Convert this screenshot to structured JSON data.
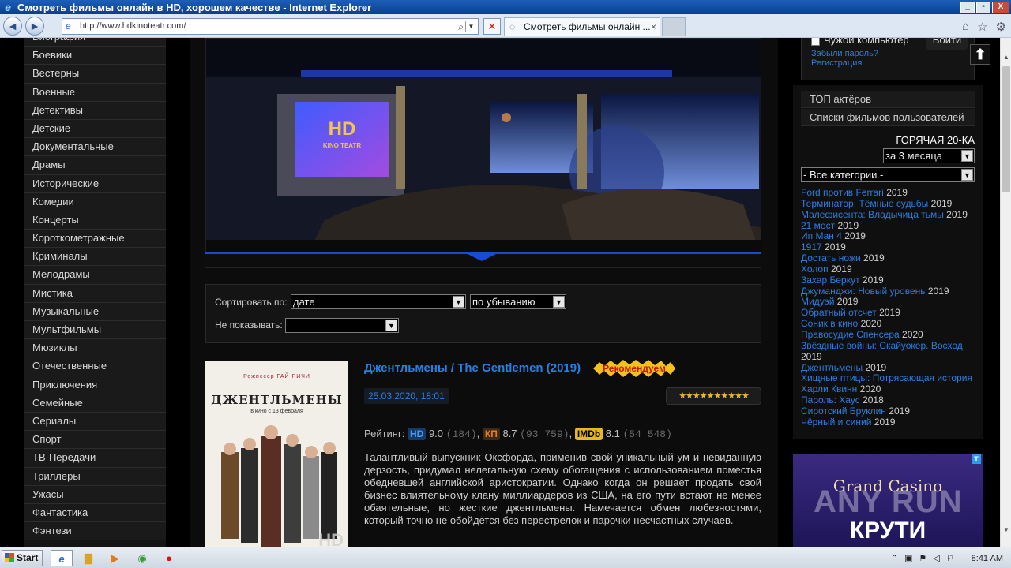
{
  "window": {
    "title": "Смотреть фильмы онлайн в HD, хорошем качестве - Internet Explorer",
    "min": "_",
    "max": "▫",
    "close": "X"
  },
  "browser": {
    "url": "http://www.hdkinoteatr.com/",
    "tab_title": "Смотреть фильмы онлайн ...",
    "tab_close": "×"
  },
  "genres": [
    "Биография",
    "Боевики",
    "Вестерны",
    "Военные",
    "Детективы",
    "Детские",
    "Документальные",
    "Драмы",
    "Исторические",
    "Комедии",
    "Концерты",
    "Короткометражные",
    "Криминалы",
    "Мелодрамы",
    "Мистика",
    "Музыкальные",
    "Мультфильмы",
    "Мюзиклы",
    "Отечественные",
    "Приключения",
    "Семейные",
    "Сериалы",
    "Спорт",
    "ТВ-Передачи",
    "Триллеры",
    "Ужасы",
    "Фантастика",
    "Фэнтези"
  ],
  "banner": {
    "logo_text": "HD",
    "logo_subtext": "KINO TEATR"
  },
  "sort": {
    "sort_label": "Сортировать по:",
    "sort_value": "дате",
    "order_value": "по убыванию",
    "hide_label": "Не показывать:",
    "hide_value": ""
  },
  "movie": {
    "title": "Джентльмены / The Gentlemen (2019)",
    "recommend": "Рекомендуем",
    "date": "25.03.2020, 18:01",
    "stars": "★★★★★★★★★★",
    "rating_label": "Рейтинг:",
    "hd_badge": "HD",
    "hd_score": "9.0",
    "hd_votes": "(184)",
    "kp_badge": "КП",
    "kp_score": "8.7",
    "kp_votes": "(93 759)",
    "imdb_badge": "IMDb",
    "imdb_score": "8.1",
    "imdb_votes": "(54 548)",
    "description": "Талантливый выпускник Оксфорда, применив свой уникальный ум и невиданную дерзость, придумал нелегальную схему обогащения с использованием поместья обедневшей английской аристократии. Однако когда он решает продать свой бизнес влиятельному клану миллиардеров из США, на его пути встают не менее обаятельные, но жесткие джентльмены. Намечается обмен любезностями, который точно не обойдется без перестрелок и парочки несчастных случаев.",
    "poster": {
      "director": "Режиссер ГАЙ РИЧИ",
      "title": "ДЖЕНТЛЬМЕНЫ",
      "release": "в кино с 13 февраля",
      "hd_mark": "HD"
    }
  },
  "login": {
    "foreign_pc": "Чужой компьютер",
    "enter": "Войти",
    "forgot": "Забыли пароль?",
    "register": "Регистрация"
  },
  "right_links": [
    "ТОП актёров",
    "Списки фильмов пользователей"
  ],
  "hot20": {
    "title": "ГОРЯЧАЯ 20-КА",
    "period": "за 3 месяца",
    "category": "- Все категории -",
    "items": [
      {
        "name": "Ford против Ferrari",
        "year": "2019"
      },
      {
        "name": "Терминатор: Тёмные судьбы",
        "year": "2019"
      },
      {
        "name": "Малефисента: Владычица тьмы",
        "year": "2019"
      },
      {
        "name": "21 мост",
        "year": "2019"
      },
      {
        "name": "Ип Ман 4",
        "year": "2019"
      },
      {
        "name": "1917",
        "year": "2019"
      },
      {
        "name": "Достать ножи",
        "year": "2019"
      },
      {
        "name": "Холоп",
        "year": "2019"
      },
      {
        "name": "Захар Беркут",
        "year": "2019"
      },
      {
        "name": "Джуманджи: Новый уровень",
        "year": "2019"
      },
      {
        "name": "Мидуэй",
        "year": "2019"
      },
      {
        "name": "Обратный отсчет",
        "year": "2019"
      },
      {
        "name": "Соник в кино",
        "year": "2020"
      },
      {
        "name": "Правосудие Спенсера",
        "year": "2020"
      },
      {
        "name": "Звёздные войны: Скайуокер. Восход",
        "year": "2019"
      },
      {
        "name": "Джентльмены",
        "year": "2019"
      },
      {
        "name": "Хищные птицы: Потрясающая история",
        "year": ""
      },
      {
        "name": "Харли Квинн",
        "year": "2020"
      },
      {
        "name": "Пароль: Хаус",
        "year": "2018"
      },
      {
        "name": "Сиротский Бруклин",
        "year": "2019"
      },
      {
        "name": "Чёрный и синий",
        "year": "2019"
      }
    ]
  },
  "ad": {
    "title": "Grand Casino",
    "big": "КРУТИ",
    "tag": "T"
  },
  "watermark": "ANY RUN",
  "taskbar": {
    "start": "Start",
    "clock": "8:41 AM"
  }
}
